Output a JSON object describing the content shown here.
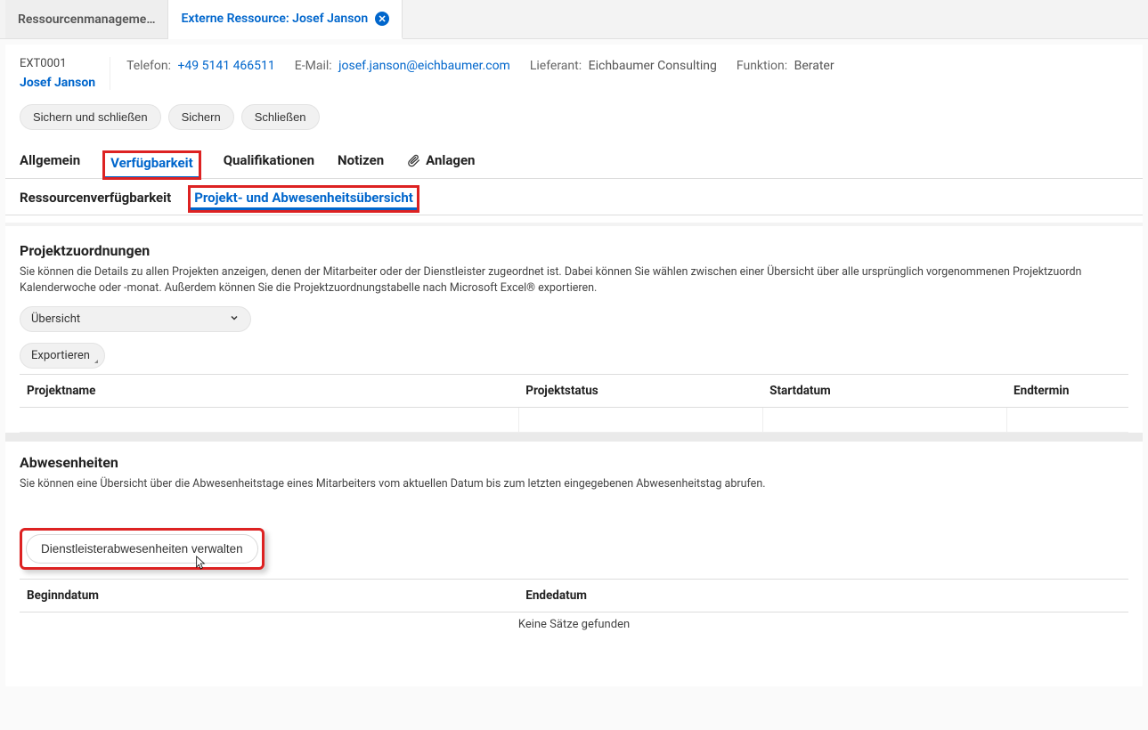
{
  "nav_tabs": {
    "inactive": "Ressourcenmanageme…",
    "active": "Externe Ressource: Josef Janson"
  },
  "header": {
    "code": "EXT0001",
    "name": "Josef Janson",
    "phone_label": "Telefon:",
    "phone_value": "+49 5141 466511",
    "email_label": "E-Mail:",
    "email_value": "josef.janson@eichbaumer.com",
    "supplier_label": "Lieferant:",
    "supplier_value": "Eichbaumer Consulting",
    "role_label": "Funktion:",
    "role_value": "Berater"
  },
  "toolbar": {
    "save_close": "Sichern und schließen",
    "save": "Sichern",
    "close": "Schließen"
  },
  "section_tabs": {
    "general": "Allgemein",
    "availability": "Verfügbarkeit",
    "qualifications": "Qualifikationen",
    "notes": "Notizen",
    "attachments": "Anlagen"
  },
  "sub_tabs": {
    "res_avail": "Ressourcenverfügbarkeit",
    "proj_abs": "Projekt- und Abwesenheitsübersicht"
  },
  "projects": {
    "title": "Projektzuordnungen",
    "desc": "Sie können die Details zu allen Projekten anzeigen, denen der Mitarbeiter oder der Dienstleister zugeordnet ist. Dabei können Sie wählen zwischen einer Übersicht über alle ursprünglich vorgenommenen Projektzuordn Kalenderwoche oder -monat. Außerdem können Sie die Projektzuordnungstabelle nach Microsoft Excel® exportieren.",
    "select_value": "Übersicht",
    "export": "Exportieren",
    "cols": {
      "name": "Projektname",
      "status": "Projektstatus",
      "start": "Startdatum",
      "end": "Endtermin"
    }
  },
  "absences": {
    "title": "Abwesenheiten",
    "desc": "Sie können eine Übersicht über die Abwesenheitstage eines Mitarbeiters vom aktuellen Datum bis zum letzten eingegebenen Abwesenheitstag abrufen.",
    "manage_btn": "Dienstleisterabwesenheiten verwalten",
    "cols": {
      "begin": "Beginndatum",
      "end": "Endedatum"
    },
    "empty": "Keine Sätze gefunden"
  }
}
